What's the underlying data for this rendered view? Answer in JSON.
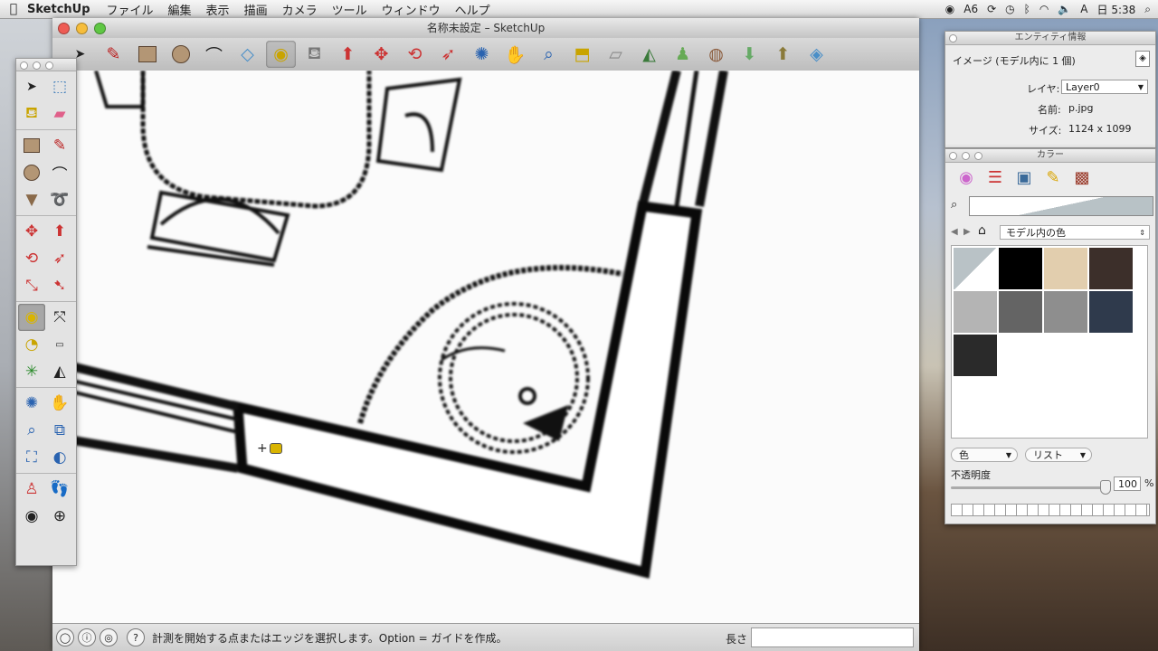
{
  "menubar": {
    "app": "SketchUp",
    "items": [
      "ファイル",
      "編集",
      "表示",
      "描画",
      "カメラ",
      "ツール",
      "ウィンドウ",
      "ヘルプ"
    ],
    "status": {
      "ime": "A",
      "number": "6",
      "text_input": "A",
      "clock": "日 5:38"
    }
  },
  "window": {
    "title": "名称未設定 – SketchUp"
  },
  "toolbar": {
    "tools": [
      "select-tool",
      "pencil-tool",
      "rectangle-tool",
      "circle-tool",
      "arc-tool",
      "eraser-tool",
      "tape-measure-tool",
      "paint-bucket-tool",
      "push-pull-tool",
      "move-tool",
      "rotate-tool",
      "follow-me-tool",
      "orbit-tool",
      "pan-tool",
      "zoom-tool",
      "zoom-extents-tool",
      "previous-view-tool",
      "add-location-tool",
      "google-earth-tool",
      "get-models-tool",
      "share-model-tool",
      "share-component-tool",
      "extension-tool"
    ],
    "active": "tape-measure-tool"
  },
  "statusbar": {
    "hint": "計測を開始する点またはエッジを選択します。Option = ガイドを作成。",
    "measure_label": "長さ",
    "measure_value": ""
  },
  "entity_info": {
    "title": "エンティティ情報",
    "selection": "イメージ (モデル内に 1 個)",
    "layer_label": "レイヤ:",
    "layer_value": "Layer0",
    "name_label": "名前:",
    "name_value": "p.jpg",
    "size_label": "サイズ:",
    "size_value": "1124 x 1099"
  },
  "colors": {
    "title": "カラー",
    "library": "モデル内の色",
    "swatches": [
      "#000000",
      "#e2ceae",
      "#3c2f2a",
      "#b4b4b4",
      "#646464",
      "#8e8e8e",
      "#2f3a4c",
      "#2a2a2a"
    ],
    "mode_select": "色",
    "view_select": "リスト",
    "opacity_label": "不透明度",
    "opacity_value": "100",
    "opacity_unit": "%"
  },
  "theme": {
    "accent": "#3b6ea5",
    "wall": "#0a0a0a"
  }
}
